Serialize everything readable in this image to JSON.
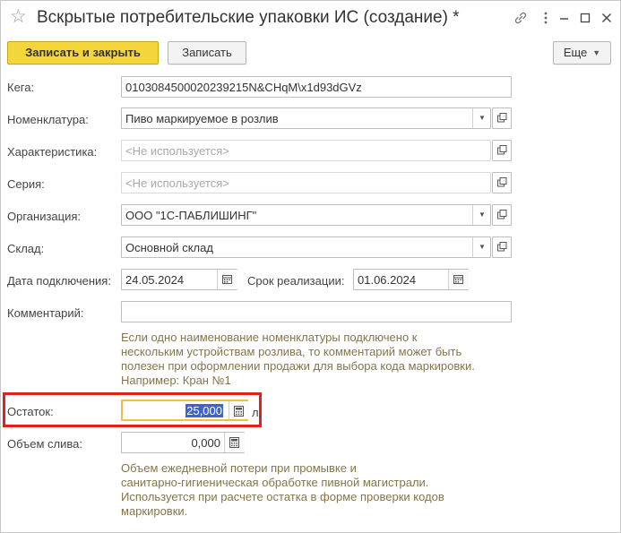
{
  "window": {
    "title": "Вскрытые потребительские упаковки ИС (создание) *"
  },
  "toolbar": {
    "save_close_label": "Записать и закрыть",
    "save_label": "Записать",
    "more_label": "Еще"
  },
  "form": {
    "kega": {
      "label": "Кега:",
      "value": "010308450002023921​5N&CHqM\\x1d93dGVz"
    },
    "nomenclature": {
      "label": "Номенклатура:",
      "value": "Пиво маркируемое в розлив"
    },
    "characteristic": {
      "label": "Характеристика:",
      "placeholder": "<Не используется>"
    },
    "series": {
      "label": "Серия:",
      "placeholder": "<Не используется>"
    },
    "organization": {
      "label": "Организация:",
      "value": "ООО \"1С-ПАБЛИШИНГ\""
    },
    "warehouse": {
      "label": "Склад:",
      "value": "Основной склад"
    },
    "connect_date": {
      "label": "Дата подключения:",
      "value": "24.05.2024"
    },
    "expiry": {
      "label": "Срок реализации:",
      "value": "01.06.2024"
    },
    "comment": {
      "label": "Комментарий:",
      "value": "",
      "hint_lines": [
        "Если одно наименование номенклатуры подключено к",
        "нескольким устройствам розлива, то комментарий может быть",
        "полезен при оформлении продажи для выбора кода маркировки.",
        "Например: Кран №1"
      ]
    },
    "remainder": {
      "label": "Остаток:",
      "value": "25,000",
      "unit": "л."
    },
    "drain_volume": {
      "label": "Объем слива:",
      "value": "0,000",
      "hint_lines": [
        "Объем ежедневной потери при промывке и",
        "санитарно-гигиеническая обработке пивной магистрали.",
        "Используется при расчете остатка в форме проверки кодов",
        "маркировки."
      ]
    }
  },
  "colors": {
    "accent_button": "#f5d53c",
    "highlight": "#e0221c",
    "hint_text": "#84754b",
    "focus_border": "#f0c040",
    "selection": "#3e64c9"
  }
}
